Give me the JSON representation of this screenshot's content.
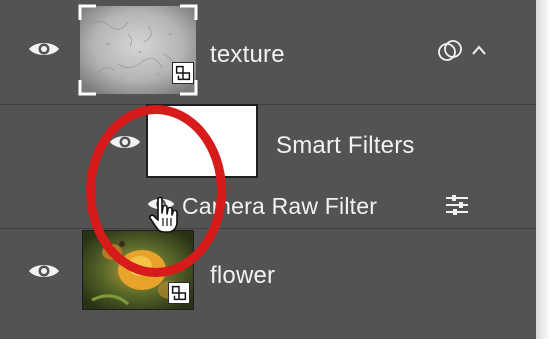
{
  "layers": [
    {
      "name": "texture",
      "visible": true,
      "selected_thumb": true,
      "expanded": true
    },
    {
      "name": "Smart Filters",
      "visible": true
    },
    {
      "name": "Camera Raw Filter",
      "visible": true
    },
    {
      "name": "flower",
      "visible": true
    }
  ],
  "colors": {
    "panel_bg": "#535353",
    "highlight_ring": "#d71a1a",
    "text": "#f2f2f2"
  },
  "icons": {
    "visibility": "eye-icon",
    "smart_object_badge": "smart-object-badge-icon",
    "blend_options": "filter-blending-options-icon",
    "link_mask": "linked-circles-icon",
    "collapse": "chevron-up-icon",
    "cursor": "hand-pointer-icon"
  }
}
